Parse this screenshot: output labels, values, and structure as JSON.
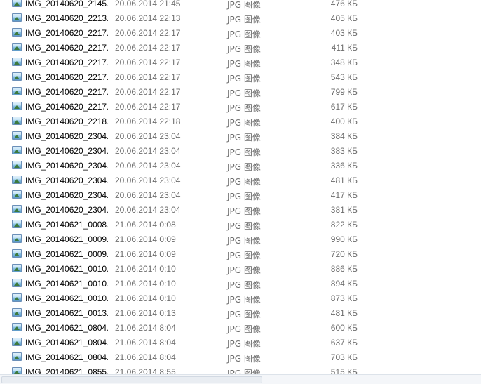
{
  "files": [
    {
      "name": "IMG_20140620_2145...",
      "date": "20.06.2014 21:45",
      "type": "JPG 图像",
      "size": "476 КБ",
      "icon": "image-file-icon"
    },
    {
      "name": "IMG_20140620_2213...",
      "date": "20.06.2014 22:13",
      "type": "JPG 图像",
      "size": "405 КБ",
      "icon": "image-file-icon"
    },
    {
      "name": "IMG_20140620_2217...",
      "date": "20.06.2014 22:17",
      "type": "JPG 图像",
      "size": "403 КБ",
      "icon": "image-file-icon"
    },
    {
      "name": "IMG_20140620_2217...",
      "date": "20.06.2014 22:17",
      "type": "JPG 图像",
      "size": "411 КБ",
      "icon": "image-file-icon"
    },
    {
      "name": "IMG_20140620_2217...",
      "date": "20.06.2014 22:17",
      "type": "JPG 图像",
      "size": "348 КБ",
      "icon": "image-file-icon"
    },
    {
      "name": "IMG_20140620_2217...",
      "date": "20.06.2014 22:17",
      "type": "JPG 图像",
      "size": "543 КБ",
      "icon": "image-file-icon"
    },
    {
      "name": "IMG_20140620_2217...",
      "date": "20.06.2014 22:17",
      "type": "JPG 图像",
      "size": "799 КБ",
      "icon": "image-file-icon"
    },
    {
      "name": "IMG_20140620_2217...",
      "date": "20.06.2014 22:17",
      "type": "JPG 图像",
      "size": "617 КБ",
      "icon": "image-file-icon"
    },
    {
      "name": "IMG_20140620_2218...",
      "date": "20.06.2014 22:18",
      "type": "JPG 图像",
      "size": "400 КБ",
      "icon": "image-file-icon"
    },
    {
      "name": "IMG_20140620_2304...",
      "date": "20.06.2014 23:04",
      "type": "JPG 图像",
      "size": "384 КБ",
      "icon": "image-file-icon"
    },
    {
      "name": "IMG_20140620_2304...",
      "date": "20.06.2014 23:04",
      "type": "JPG 图像",
      "size": "383 КБ",
      "icon": "image-file-icon"
    },
    {
      "name": "IMG_20140620_2304...",
      "date": "20.06.2014 23:04",
      "type": "JPG 图像",
      "size": "336 КБ",
      "icon": "image-file-icon"
    },
    {
      "name": "IMG_20140620_2304...",
      "date": "20.06.2014 23:04",
      "type": "JPG 图像",
      "size": "481 КБ",
      "icon": "image-file-icon"
    },
    {
      "name": "IMG_20140620_2304...",
      "date": "20.06.2014 23:04",
      "type": "JPG 图像",
      "size": "417 КБ",
      "icon": "image-file-icon"
    },
    {
      "name": "IMG_20140620_2304...",
      "date": "20.06.2014 23:04",
      "type": "JPG 图像",
      "size": "381 КБ",
      "icon": "image-file-icon"
    },
    {
      "name": "IMG_20140621_0008...",
      "date": "21.06.2014 0:08",
      "type": "JPG 图像",
      "size": "822 КБ",
      "icon": "image-file-icon"
    },
    {
      "name": "IMG_20140621_0009...",
      "date": "21.06.2014 0:09",
      "type": "JPG 图像",
      "size": "990 КБ",
      "icon": "image-file-icon"
    },
    {
      "name": "IMG_20140621_0009...",
      "date": "21.06.2014 0:09",
      "type": "JPG 图像",
      "size": "720 КБ",
      "icon": "image-file-icon"
    },
    {
      "name": "IMG_20140621_0010...",
      "date": "21.06.2014 0:10",
      "type": "JPG 图像",
      "size": "886 КБ",
      "icon": "image-file-icon"
    },
    {
      "name": "IMG_20140621_0010...",
      "date": "21.06.2014 0:10",
      "type": "JPG 图像",
      "size": "894 КБ",
      "icon": "image-file-icon"
    },
    {
      "name": "IMG_20140621_0010...",
      "date": "21.06.2014 0:10",
      "type": "JPG 图像",
      "size": "873 КБ",
      "icon": "image-file-icon"
    },
    {
      "name": "IMG_20140621_0013...",
      "date": "21.06.2014 0:13",
      "type": "JPG 图像",
      "size": "481 КБ",
      "icon": "image-file-icon"
    },
    {
      "name": "IMG_20140621_0804...",
      "date": "21.06.2014 8:04",
      "type": "JPG 图像",
      "size": "600 КБ",
      "icon": "image-file-icon"
    },
    {
      "name": "IMG_20140621_0804...",
      "date": "21.06.2014 8:04",
      "type": "JPG 图像",
      "size": "637 КБ",
      "icon": "image-file-icon"
    },
    {
      "name": "IMG_20140621_0804...",
      "date": "21.06.2014 8:04",
      "type": "JPG 图像",
      "size": "703 КБ",
      "icon": "image-file-icon"
    },
    {
      "name": "IMG_20140621_0855...",
      "date": "21.06.2014 8:55",
      "type": "JPG 图像",
      "size": "515 КБ",
      "icon": "image-file-icon"
    }
  ],
  "colors": {
    "background": "#ffffff",
    "name_text": "#000000",
    "meta_text": "#6d6d6d"
  }
}
